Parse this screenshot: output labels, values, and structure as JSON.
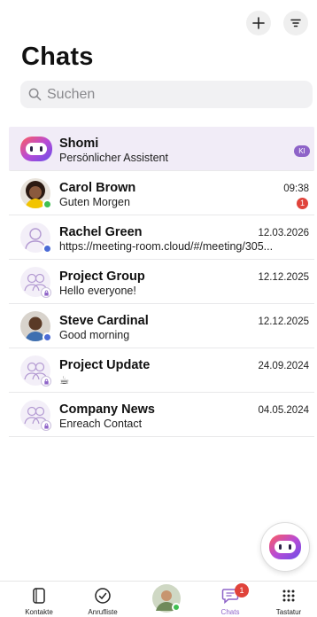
{
  "header": {
    "title": "Chats"
  },
  "search": {
    "placeholder": "Suchen"
  },
  "chats": [
    {
      "name": "Shomi",
      "subtitle": "Persönlicher Assistent",
      "time": "",
      "badge": "KI",
      "avatar": "assistant-logo"
    },
    {
      "name": "Carol Brown",
      "subtitle": "Guten Morgen",
      "time": "09:38",
      "unread": "1",
      "avatar": "person-photo",
      "status": "online"
    },
    {
      "name": "Rachel Green",
      "subtitle": "https://meeting-room.cloud/#/meeting/305...",
      "time": "12.03.2026",
      "avatar": "person-outline",
      "status": "away"
    },
    {
      "name": "Project Group",
      "subtitle": "Hello everyone!",
      "time": "12.12.2025",
      "avatar": "group-icon"
    },
    {
      "name": "Steve Cardinal",
      "subtitle": "Good morning",
      "time": "12.12.2025",
      "avatar": "person-photo",
      "status": "away"
    },
    {
      "name": "Project Update",
      "subtitle": "☕",
      "time": "24.09.2024",
      "avatar": "group-icon"
    },
    {
      "name": "Company News",
      "subtitle": "Enreach Contact",
      "time": "04.05.2024",
      "avatar": "group-icon"
    }
  ],
  "tabs": [
    {
      "label": "Kontakte",
      "icon": "phone-book-icon"
    },
    {
      "label": "Anrufliste",
      "icon": "call-history-icon"
    },
    {
      "label": "",
      "icon": "profile-avatar"
    },
    {
      "label": "Chats",
      "icon": "chat-icon",
      "badge": "1"
    },
    {
      "label": "Tastatur",
      "icon": "keypad-icon"
    }
  ],
  "colors": {
    "accent": "#8e63c8",
    "unread": "#e0433b",
    "online": "#3fbf52",
    "away": "#4b6bd6"
  }
}
